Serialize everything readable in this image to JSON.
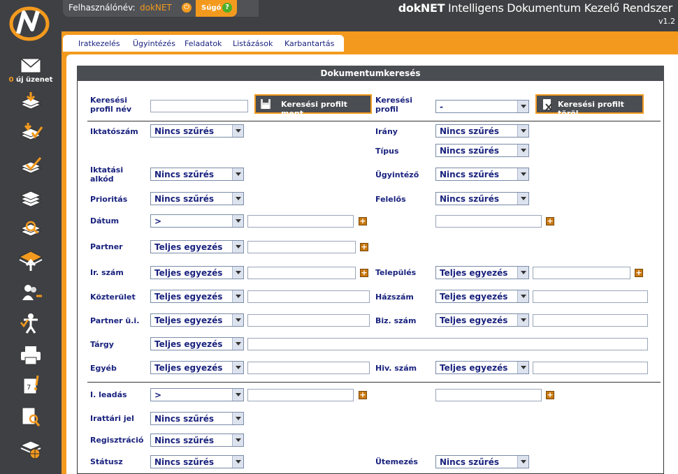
{
  "header": {
    "user_label": "Felhasználónév:",
    "username": "dokNET",
    "help_label": "Súgó",
    "help_icon": "?",
    "power_icon": "⏻",
    "title_bold": "dokNET",
    "title_rest": " Intelligens Dokumentum Kezelő Rendszer",
    "version": "v1.2"
  },
  "menu": [
    "Iratkezelés",
    "Ügyintézés",
    "Feladatok",
    "Listázások",
    "Karbantartás"
  ],
  "sidebar": {
    "msg_count": "0",
    "msg_label": " új üzenet"
  },
  "panel": {
    "title": "Dokumentumkeresés",
    "profile_name_label": "Keresési profil név",
    "save_profile_label": "Keresési profilt ment",
    "profile_label": "Keresési profil",
    "profile_value": "-",
    "delete_profile_label": "Keresési profilt töröl"
  },
  "fields": {
    "iktatoszam": {
      "label": "Iktatószám",
      "value": "Nincs szűrés"
    },
    "irany": {
      "label": "Irány",
      "value": "Nincs szűrés"
    },
    "tipus": {
      "label": "Típus",
      "value": "Nincs szűrés"
    },
    "iktatasi_alkod": {
      "label": "Iktatási alkód",
      "value": "Nincs szűrés"
    },
    "ugyintezo": {
      "label": "Ügyintéző",
      "value": "Nincs szűrés"
    },
    "prioritas": {
      "label": "Prioritás",
      "value": "Nincs szűrés"
    },
    "felelos": {
      "label": "Felelős",
      "value": "Nincs szűrés"
    },
    "datum": {
      "label": "Dátum",
      "value": ">"
    },
    "partner": {
      "label": "Partner",
      "value": "Teljes egyezés"
    },
    "ir_szam": {
      "label": "Ir. szám",
      "value": "Teljes egyezés"
    },
    "telepules": {
      "label": "Település",
      "value": "Teljes egyezés"
    },
    "kozterulet": {
      "label": "Közterület",
      "value": "Teljes egyezés"
    },
    "hazszam": {
      "label": "Házszám",
      "value": "Teljes egyezés"
    },
    "partner_ui": {
      "label": "Partner ü.i.",
      "value": "Teljes egyezés"
    },
    "biz_szam": {
      "label": "Biz. szám",
      "value": "Teljes egyezés"
    },
    "targy": {
      "label": "Tárgy",
      "value": "Teljes egyezés"
    },
    "egyeb": {
      "label": "Egyéb",
      "value": "Teljes egyezés"
    },
    "hiv_szam": {
      "label": "Hiv. szám",
      "value": "Teljes egyezés"
    },
    "i_leadas": {
      "label": "I. leadás",
      "value": ">"
    },
    "irattari_jel": {
      "label": "Irattári jel",
      "value": "Nincs szűrés"
    },
    "regisztracio": {
      "label": "Regisztráció",
      "value": "Nincs szűrés"
    },
    "statusz": {
      "label": "Státusz",
      "value": "Nincs szűrés"
    },
    "utemezes": {
      "label": "Ütemezés",
      "value": "Nincs szűrés"
    }
  },
  "plus_glyph": "+"
}
